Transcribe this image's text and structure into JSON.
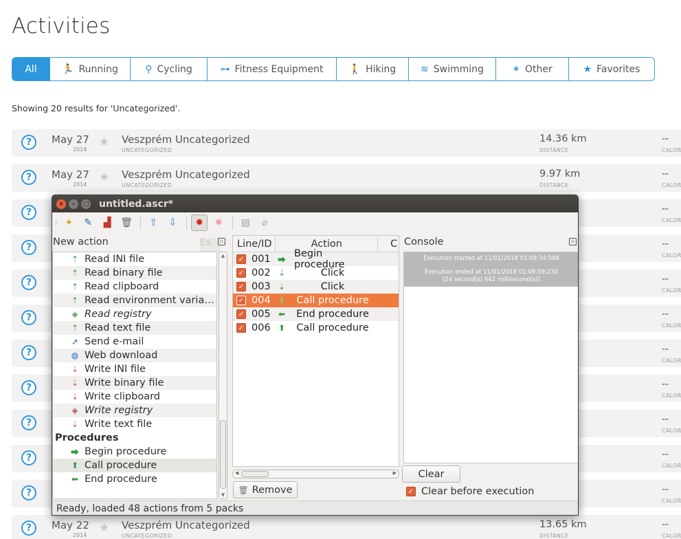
{
  "page": {
    "title": "Activities",
    "showing": "Showing 20 results for 'Uncategorized'.",
    "tabs": [
      {
        "label": "All",
        "icon": "",
        "active": true
      },
      {
        "label": "Running",
        "icon": "running-icon"
      },
      {
        "label": "Cycling",
        "icon": "cycling-icon"
      },
      {
        "label": "Fitness Equipment",
        "icon": "dumbbell-icon"
      },
      {
        "label": "Hiking",
        "icon": "hiking-icon"
      },
      {
        "label": "Swimming",
        "icon": "swimming-icon"
      },
      {
        "label": "Other",
        "icon": "other-icon"
      },
      {
        "label": "Favorites",
        "icon": "star-icon"
      }
    ],
    "rows": [
      {
        "date": "May 27",
        "year": "2014",
        "name": "Veszprém Uncategorized",
        "category": "UNCATEGORIZED",
        "distance": "14.36 km",
        "distance_label": "DISTANCE",
        "calories": "--",
        "calories_label": "CALOR"
      },
      {
        "date": "May 27",
        "year": "2014",
        "name": "Veszprém Uncategorized",
        "category": "UNCATEGORIZED",
        "distance": "9.97 km",
        "distance_label": "DISTANCE",
        "calories": "--",
        "calories_label": "CALOR"
      },
      {
        "date": "",
        "year": "",
        "name": "",
        "category": "",
        "distance": "n",
        "distance_label": "",
        "calories": "--",
        "calories_label": "CALOR"
      },
      {
        "date": "",
        "year": "",
        "name": "",
        "category": "",
        "distance": "km",
        "distance_label": "",
        "calories": "--",
        "calories_label": "CALOR"
      },
      {
        "date": "",
        "year": "",
        "name": "",
        "category": "",
        "distance": "n",
        "distance_label": "",
        "calories": "--",
        "calories_label": "CALOR"
      },
      {
        "date": "",
        "year": "",
        "name": "",
        "category": "",
        "distance": "n",
        "distance_label": "",
        "calories": "--",
        "calories_label": "CALOR"
      },
      {
        "date": "",
        "year": "",
        "name": "",
        "category": "",
        "distance": "n",
        "distance_label": "",
        "calories": "--",
        "calories_label": "CALOR"
      },
      {
        "date": "",
        "year": "",
        "name": "",
        "category": "",
        "distance": "n",
        "distance_label": "",
        "calories": "--",
        "calories_label": "CALOR"
      },
      {
        "date": "",
        "year": "",
        "name": "",
        "category": "",
        "distance": "",
        "distance_label": "",
        "calories": "--",
        "calories_label": "CALOR"
      },
      {
        "date": "",
        "year": "",
        "name": "",
        "category": "",
        "distance": "",
        "distance_label": "",
        "calories": "--",
        "calories_label": "CALOR"
      },
      {
        "date": "",
        "year": "",
        "name": "",
        "category": "",
        "distance": "",
        "distance_label": "",
        "calories": "--",
        "calories_label": "CALOR"
      },
      {
        "date": "May 22",
        "year": "2014",
        "name": "Veszprém Uncategorized",
        "category": "UNCATEGORIZED",
        "distance": "13.65 km",
        "distance_label": "DISTANCE",
        "calories": "--",
        "calories_label": "CALOR"
      }
    ]
  },
  "window": {
    "title": "untitled.ascr*",
    "toolbar": [
      "new-icon",
      "open-icon",
      "save-icon",
      "delete-icon",
      "up-arrow-icon",
      "down-arrow-icon",
      "run-icon",
      "stop-icon",
      "log-icon",
      "attach-icon"
    ],
    "new_action": {
      "title": "New action",
      "filter_hint": "Ex",
      "items": [
        {
          "label": "Read INI file",
          "icon": "read-icon",
          "italic": false
        },
        {
          "label": "Read binary file",
          "icon": "read-icon",
          "italic": false
        },
        {
          "label": "Read clipboard",
          "icon": "read-icon",
          "italic": false
        },
        {
          "label": "Read environment varia…",
          "icon": "read-icon",
          "italic": false
        },
        {
          "label": "Read registry",
          "icon": "registry-icon",
          "italic": true
        },
        {
          "label": "Read text file",
          "icon": "read-icon",
          "italic": false
        },
        {
          "label": "Send e-mail",
          "icon": "email-icon",
          "italic": false
        },
        {
          "label": "Web download",
          "icon": "globe-icon",
          "italic": false
        },
        {
          "label": "Write INI file",
          "icon": "write-icon",
          "italic": false
        },
        {
          "label": "Write binary file",
          "icon": "write-icon",
          "italic": false
        },
        {
          "label": "Write clipboard",
          "icon": "write-icon",
          "italic": false
        },
        {
          "label": "Write registry",
          "icon": "registry-icon",
          "italic": true
        },
        {
          "label": "Write text file",
          "icon": "write-icon",
          "italic": false
        }
      ],
      "group": "Procedures",
      "procedures": [
        {
          "label": "Begin procedure",
          "icon": "begin-procedure-icon"
        },
        {
          "label": "Call procedure",
          "icon": "call-procedure-icon",
          "highlight": true
        },
        {
          "label": "End procedure",
          "icon": "end-procedure-icon"
        }
      ]
    },
    "script": {
      "columns": [
        "Line/ID",
        "Action",
        "C"
      ],
      "rows": [
        {
          "id": "001",
          "action": "Begin procedure",
          "icon": "begin-procedure-icon",
          "checked": true,
          "selected": false,
          "indent": false
        },
        {
          "id": "002",
          "action": "Click",
          "icon": "click-icon",
          "checked": true,
          "selected": false,
          "indent": true
        },
        {
          "id": "003",
          "action": "Click",
          "icon": "click-icon",
          "checked": true,
          "selected": false,
          "indent": true
        },
        {
          "id": "004",
          "action": "Call procedure",
          "icon": "call-procedure-icon",
          "checked": true,
          "selected": true,
          "indent": true
        },
        {
          "id": "005",
          "action": "End procedure",
          "icon": "end-procedure-icon",
          "checked": true,
          "selected": false,
          "indent": false
        },
        {
          "id": "006",
          "action": "Call procedure",
          "icon": "call-procedure-icon",
          "checked": true,
          "selected": false,
          "indent": false
        }
      ],
      "remove_label": "Remove"
    },
    "console": {
      "title": "Console",
      "line1": "Execution started at 11/01/2018 01:09:34:588",
      "line2": "Execution ended at 11/01/2018 01:09:59:230",
      "line3": "(24 second(s) 642 millisecond(s))",
      "clear_label": "Clear",
      "clear_before_label": "Clear before execution",
      "clear_before_checked": true
    },
    "status": "Ready, loaded 48 actions from 5 packs"
  },
  "colors": {
    "accent": "#2d96dd",
    "selection": "#ef7a3e",
    "checkbox": "#e1633a",
    "titlebar": "#3c3b37"
  }
}
